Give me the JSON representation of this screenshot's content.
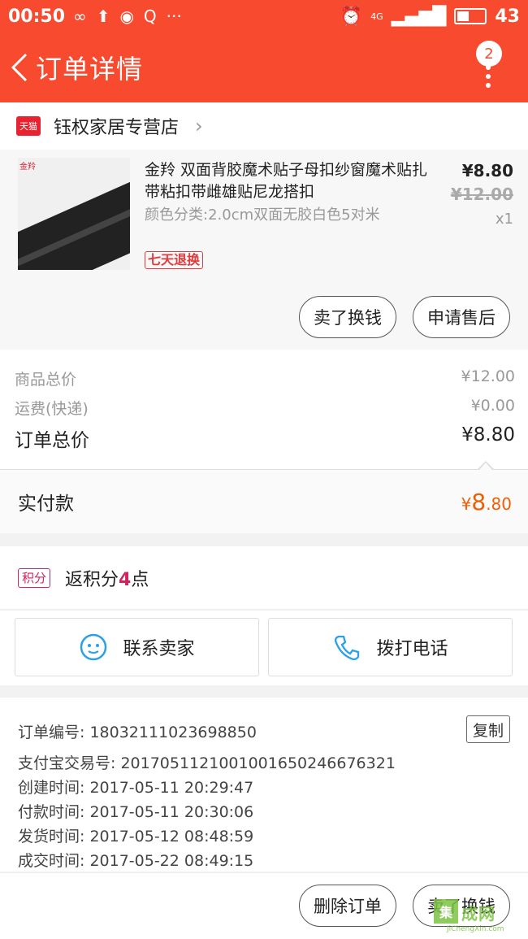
{
  "status_bar": {
    "time": "00:50",
    "battery": "43",
    "network": "4G"
  },
  "header": {
    "title": "订单详情",
    "badge_count": "2"
  },
  "shop": {
    "platform_tag": "天猫",
    "name": "钰权家居专营店"
  },
  "product": {
    "thumb_brand": "金羚",
    "title": "金羚 双面背胶魔术贴子母扣纱窗魔术贴扎带粘扣带雌雄贴尼龙搭扣",
    "spec": "颜色分类:2.0cm双面无胶白色5对米",
    "tag": "七天退换",
    "price": "¥8.80",
    "original_price": "¥12.00",
    "quantity": "x1",
    "sell_label": "卖了换钱",
    "aftersale_label": "申请售后"
  },
  "summary": {
    "goods_label": "商品总价",
    "goods_value": "¥12.00",
    "shipping_label": "运费(快递)",
    "shipping_value": "¥0.00",
    "total_label": "订单总价",
    "total_value": "¥8.80",
    "paid_label": "实付款",
    "paid_currency": "¥",
    "paid_int": "8",
    "paid_dec": ".80"
  },
  "points": {
    "tag": "积分",
    "prefix": "返积分",
    "value": "4",
    "suffix": "点"
  },
  "contact": {
    "seller_label": "联系卖家",
    "call_label": "拨打电话"
  },
  "order_info": {
    "order_no": "订单编号: 18032111023698850",
    "copy_label": "复制",
    "alipay_no": "支付宝交易号: 2017051121001001650246676321",
    "created": "创建时间: 2017-05-11 20:29:47",
    "paid": "付款时间: 2017-05-11 20:30:06",
    "shipped": "发货时间: 2017-05-12 08:48:59",
    "completed": "成交时间: 2017-05-22 08:49:15"
  },
  "bottom": {
    "delete_label": "删除订单",
    "sell_label": "卖了换钱"
  },
  "watermark": {
    "box": "集",
    "text": "成网",
    "sub": "JiChengXin.com"
  },
  "colors": {
    "brand": "#f84a2e",
    "price_orange": "#f25c05",
    "points_pink": "#d0245d",
    "watermark_green": "#7cc242"
  }
}
